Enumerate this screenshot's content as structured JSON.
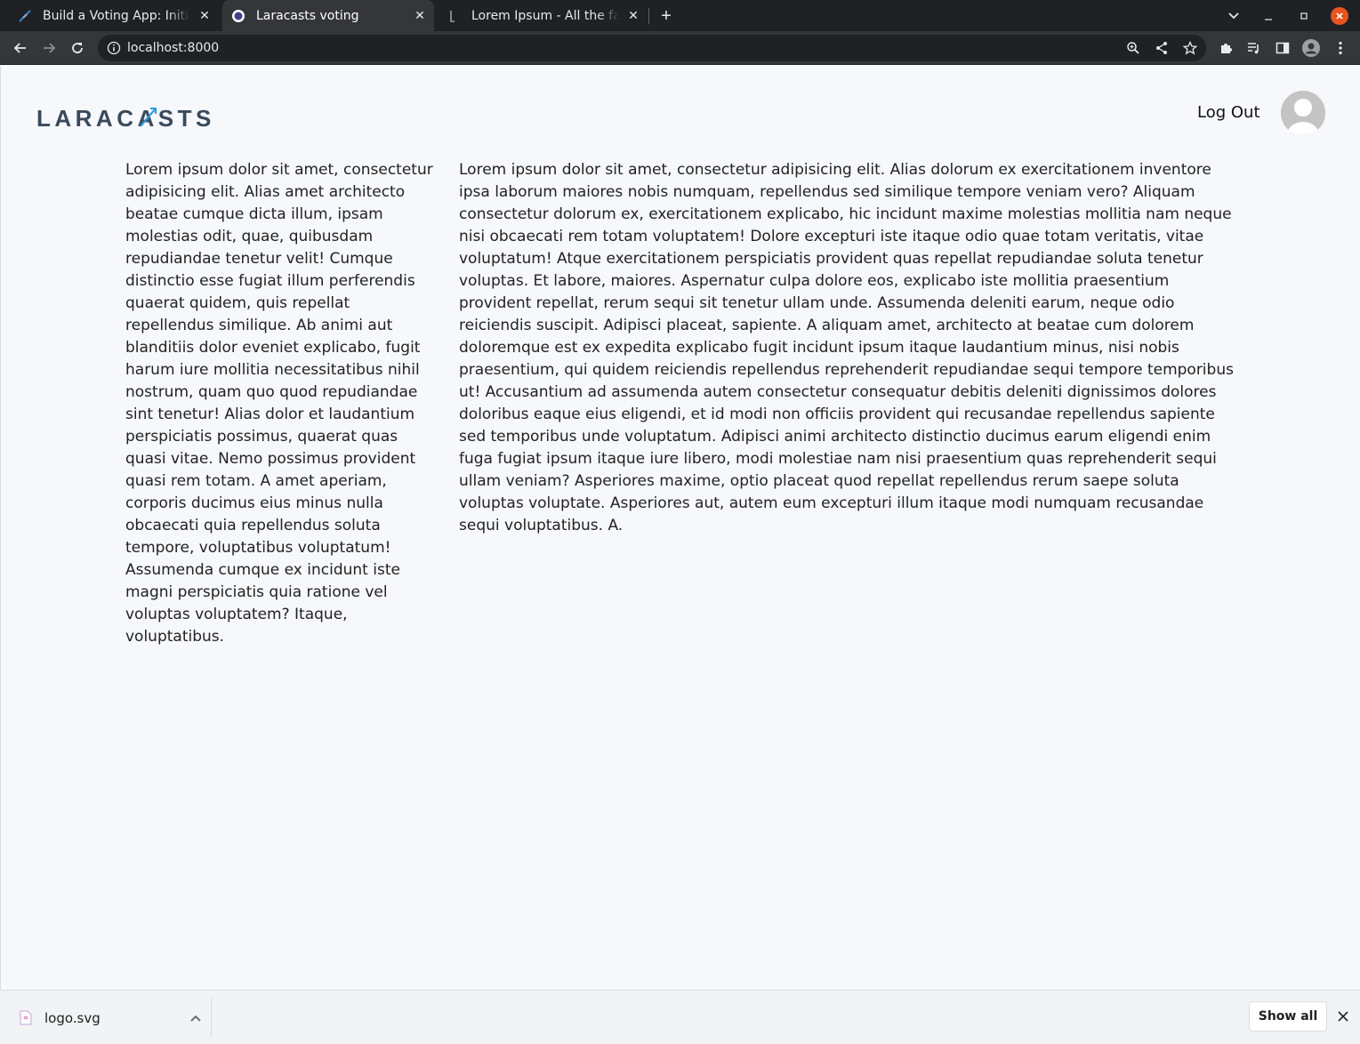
{
  "browser": {
    "tabs": [
      {
        "title": "Build a Voting App: Initial",
        "favicon": "laracasts-icon",
        "active": false
      },
      {
        "title": "Laracasts voting",
        "favicon": "globe-icon",
        "active": true
      },
      {
        "title": "Lorem Ipsum - All the fact",
        "favicon": "lorem-icon",
        "active": false
      }
    ],
    "new_tab_label": "+",
    "url": "localhost:8000"
  },
  "header": {
    "logo_text": "LARACASTS",
    "logout_label": "Log Out"
  },
  "content": {
    "left_text": "Lorem ipsum dolor sit amet, consectetur adipisicing elit. Alias amet architecto beatae cumque dicta illum, ipsam molestias odit, quae, quibusdam repudiandae tenetur velit! Cumque distinctio esse fugiat illum perferendis quaerat quidem, quis repellat repellendus similique. Ab animi aut blanditiis dolor eveniet explicabo, fugit harum iure mollitia necessitatibus nihil nostrum, quam quo quod repudiandae sint tenetur! Alias dolor et laudantium perspiciatis possimus, quaerat quas quasi vitae. Nemo possimus provident quasi rem totam. A amet aperiam, corporis ducimus eius minus nulla obcaecati quia repellendus soluta tempore, voluptatibus voluptatum! Assumenda cumque ex incidunt iste magni perspiciatis quia ratione vel voluptas voluptatem? Itaque, voluptatibus.",
    "right_text": "Lorem ipsum dolor sit amet, consectetur adipisicing elit. Alias dolorum ex exercitationem inventore ipsa laborum maiores nobis numquam, repellendus sed similique tempore veniam vero? Aliquam consectetur dolorum ex, exercitationem explicabo, hic incidunt maxime molestias mollitia nam neque nisi obcaecati rem totam voluptatem! Dolore excepturi iste itaque odio quae totam veritatis, vitae voluptatum! Atque exercitationem perspiciatis provident quas repellat repudiandae soluta tenetur voluptas. Et labore, maiores. Aspernatur culpa dolore eos, explicabo iste mollitia praesentium provident repellat, rerum sequi sit tenetur ullam unde. Assumenda deleniti earum, neque odio reiciendis suscipit. Adipisci placeat, sapiente. A aliquam amet, architecto at beatae cum dolorem doloremque est ex expedita explicabo fugit incidunt ipsum itaque laudantium minus, nisi nobis praesentium, qui quidem reiciendis repellendus reprehenderit repudiandae sequi tempore temporibus ut! Accusantium ad assumenda autem consectetur consequatur debitis deleniti dignissimos dolores doloribus eaque eius eligendi, et id modi non officiis provident qui recusandae repellendus sapiente sed temporibus unde voluptatum. Adipisci animi architecto distinctio ducimus earum eligendi enim fuga fugiat ipsum itaque iure libero, modi molestiae nam nisi praesentium quas reprehenderit sequi ullam veniam? Asperiores maxime, optio placeat quod repellat repellendus rerum saepe soluta voluptas voluptate. Asperiores aut, autem eum excepturi illum itaque modi numquam recusandae sequi voluptatibus. A."
  },
  "downloads": {
    "file_name": "logo.svg",
    "show_all_label": "Show all"
  },
  "colors": {
    "accent_orange": "#e95420",
    "logo_blue": "#2d9cdb",
    "logo_dark": "#3a4a5c"
  }
}
